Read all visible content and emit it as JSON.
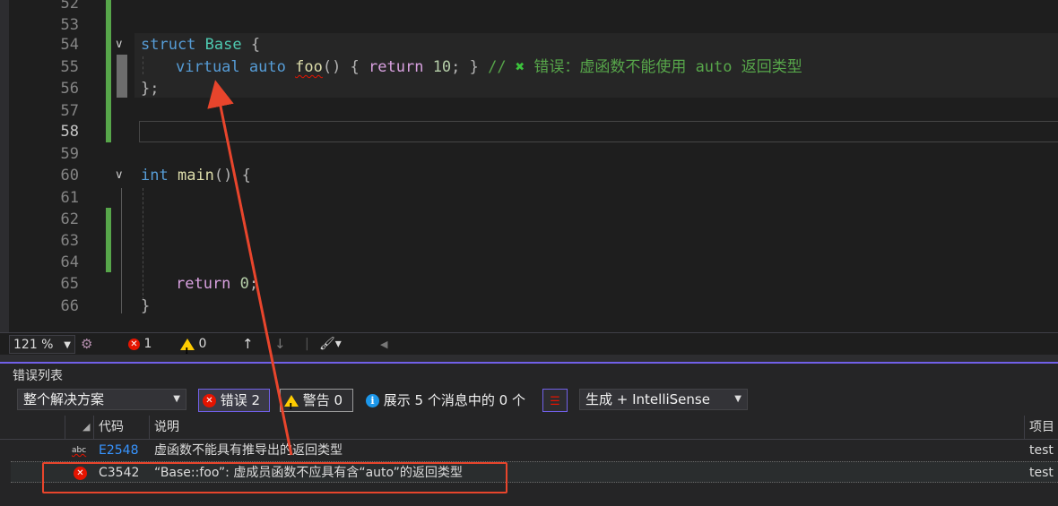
{
  "editor": {
    "lines": [
      {
        "n": "52"
      },
      {
        "n": "53"
      },
      {
        "n": "54"
      },
      {
        "n": "55"
      },
      {
        "n": "56"
      },
      {
        "n": "57"
      },
      {
        "n": "58"
      },
      {
        "n": "59"
      },
      {
        "n": "60"
      },
      {
        "n": "61"
      },
      {
        "n": "62"
      },
      {
        "n": "63"
      },
      {
        "n": "64"
      },
      {
        "n": "65"
      },
      {
        "n": "66"
      }
    ],
    "tokens": {
      "struct": "struct",
      "base": "Base",
      "brace_open": " {",
      "virtual": "virtual",
      "auto": "auto",
      "foo": "foo",
      "foo_paren": "() { ",
      "ret": "return",
      "ten": "10",
      "semi_close": "; } ",
      "comment_slashes": "// ",
      "comment_text": " 错误：虚函数不能使用 auto 返回类型",
      "close_semi": "};",
      "int": "int",
      "main": "main",
      "main_paren": "() {",
      "return2": "return",
      "zero": "0",
      "semi": ";",
      "close": "}"
    }
  },
  "statusbar": {
    "zoom": "121 %",
    "errors": "1",
    "warnings": "0"
  },
  "error_list": {
    "title": "错误列表",
    "scope": "整个解决方案",
    "errors_btn": "错误 2",
    "warnings_btn": "警告 0",
    "messages_btn": "展示 5 个消息中的 0 个",
    "build_filter": "生成 + IntelliSense",
    "columns": {
      "code": "代码",
      "desc": "说明",
      "project": "项目"
    },
    "rows": [
      {
        "icon_label": "abc",
        "code": "E2548",
        "desc": "虚函数不能具有推导出的返回类型",
        "project": "test"
      },
      {
        "code": "C3542",
        "desc": "“Base::foo”: 虚成员函数不应具有含“auto”的返回类型",
        "project": "test"
      }
    ]
  }
}
